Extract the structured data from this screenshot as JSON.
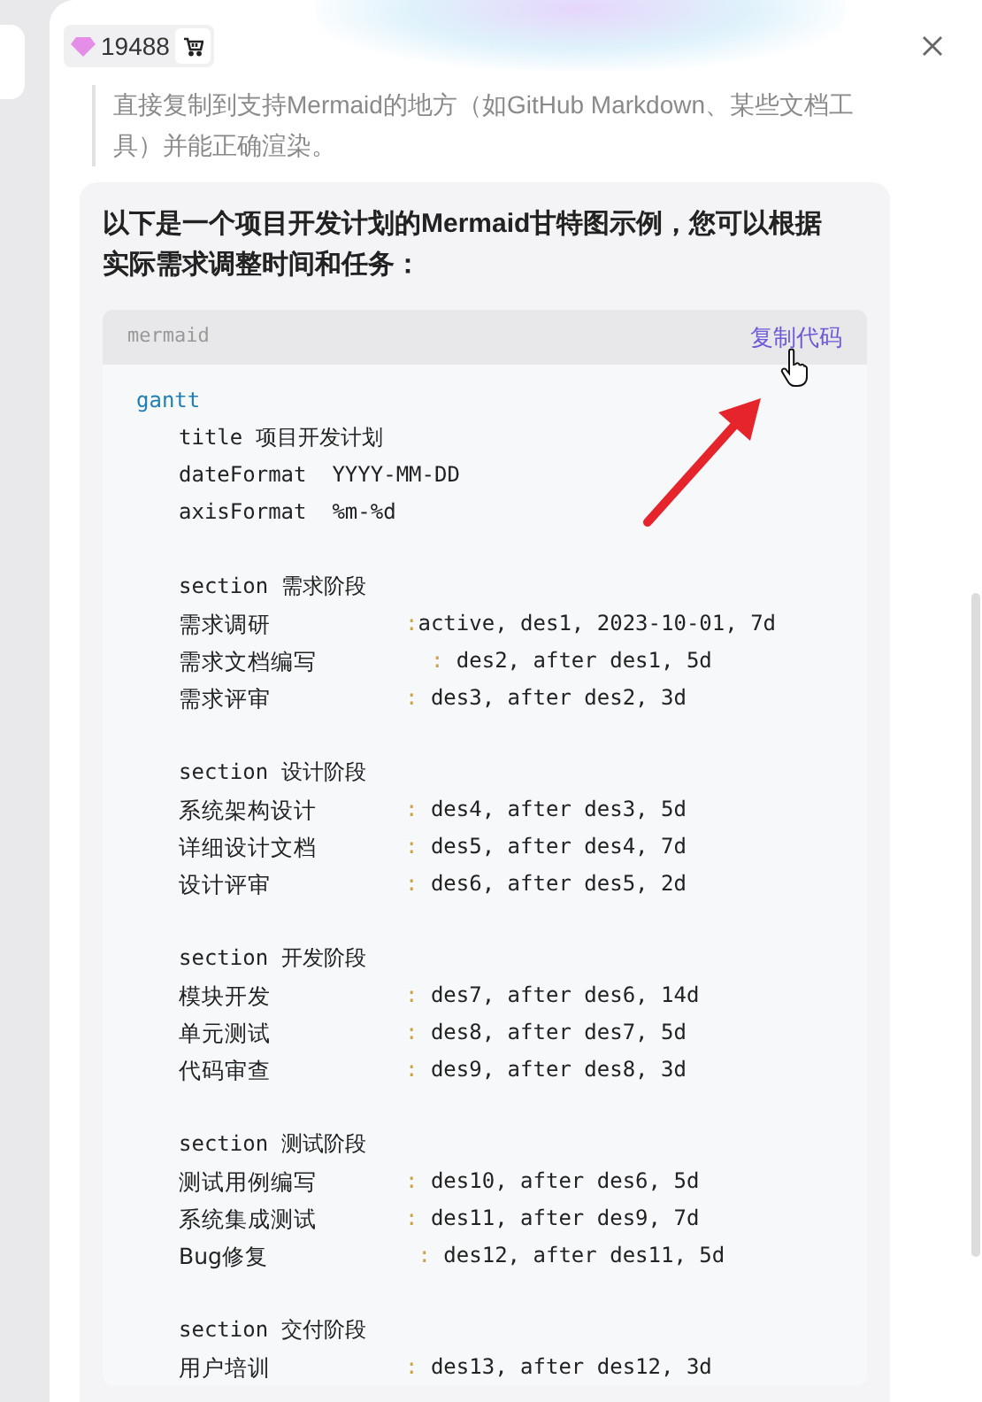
{
  "header": {
    "points": "19488"
  },
  "quote": "直接复制到支持Mermaid的地方（如GitHub Markdown、某些文档工具）并能正确渲染。",
  "message": {
    "text": "以下是一个项目开发计划的Mermaid甘特图示例，您可以根据实际需求调整时间和任务：",
    "code": {
      "language": "mermaid",
      "copy_label": "复制代码",
      "lines": [
        {
          "kind": "keyword",
          "text": "gantt"
        },
        {
          "kind": "directive",
          "text": "title 项目开发计划"
        },
        {
          "kind": "directive",
          "text": "dateFormat  YYYY-MM-DD"
        },
        {
          "kind": "directive",
          "text": "axisFormat  %m-%d"
        },
        {
          "kind": "blank"
        },
        {
          "kind": "directive",
          "text": "section 需求阶段"
        },
        {
          "kind": "task",
          "label": "需求调研",
          "spec": ":active, des1, 2023-10-01, 7d"
        },
        {
          "kind": "task",
          "label": "需求文档编写",
          "spec": "  : des2, after des1, 5d"
        },
        {
          "kind": "task",
          "label": "需求评审",
          "spec": ": des3, after des2, 3d"
        },
        {
          "kind": "blank"
        },
        {
          "kind": "directive",
          "text": "section 设计阶段"
        },
        {
          "kind": "task",
          "label": "系统架构设计",
          "spec": ": des4, after des3, 5d"
        },
        {
          "kind": "task",
          "label": "详细设计文档",
          "spec": ": des5, after des4, 7d"
        },
        {
          "kind": "task",
          "label": "设计评审",
          "spec": ": des6, after des5, 2d"
        },
        {
          "kind": "blank"
        },
        {
          "kind": "directive",
          "text": "section 开发阶段"
        },
        {
          "kind": "task",
          "label": "模块开发",
          "spec": ": des7, after des6, 14d"
        },
        {
          "kind": "task",
          "label": "单元测试",
          "spec": ": des8, after des7, 5d"
        },
        {
          "kind": "task",
          "label": "代码审查",
          "spec": ": des9, after des8, 3d"
        },
        {
          "kind": "blank"
        },
        {
          "kind": "directive",
          "text": "section 测试阶段"
        },
        {
          "kind": "task",
          "label": "测试用例编写",
          "spec": ": des10, after des6, 5d"
        },
        {
          "kind": "task",
          "label": "系统集成测试",
          "spec": ": des11, after des9, 7d"
        },
        {
          "kind": "task",
          "label": "Bug修复",
          "spec": " : des12, after des11, 5d"
        },
        {
          "kind": "blank"
        },
        {
          "kind": "directive",
          "text": "section 交付阶段"
        },
        {
          "kind": "task",
          "label": "用户培训",
          "spec": ": des13, after des12, 3d"
        }
      ]
    }
  }
}
